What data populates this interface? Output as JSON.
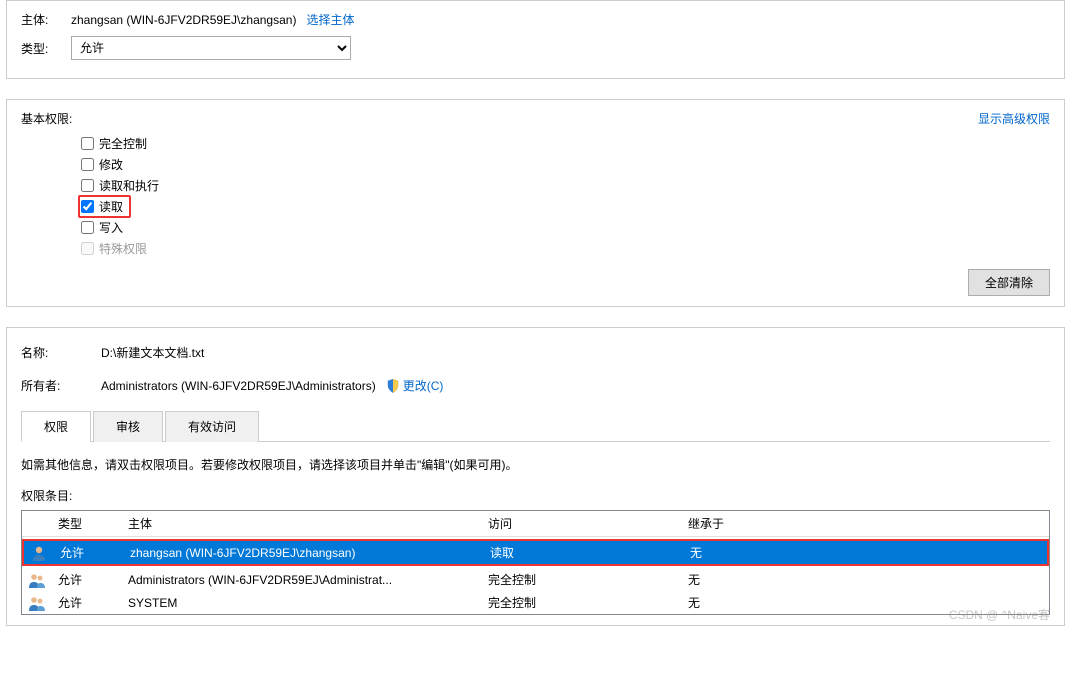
{
  "top": {
    "principal_label": "主体:",
    "principal_name": "zhangsan (WIN-6JFV2DR59EJ\\zhangsan)",
    "select_principal_link": "选择主体",
    "type_label": "类型:",
    "type_value": "允许"
  },
  "permissions_panel": {
    "title": "基本权限:",
    "show_advanced": "显示高级权限",
    "items": [
      {
        "label": "完全控制",
        "checked": false,
        "disabled": false
      },
      {
        "label": "修改",
        "checked": false,
        "disabled": false
      },
      {
        "label": "读取和执行",
        "checked": false,
        "disabled": false
      },
      {
        "label": "读取",
        "checked": true,
        "disabled": false,
        "highlight": true
      },
      {
        "label": "写入",
        "checked": false,
        "disabled": false
      },
      {
        "label": "特殊权限",
        "checked": false,
        "disabled": true
      }
    ],
    "clear_all": "全部清除"
  },
  "advanced": {
    "name_label": "名称:",
    "name_value": "D:\\新建文本文档.txt",
    "owner_label": "所有者:",
    "owner_value": "Administrators (WIN-6JFV2DR59EJ\\Administrators)",
    "change_link": "更改(C)",
    "tabs": [
      "权限",
      "审核",
      "有效访问"
    ],
    "active_tab": 0,
    "instruction": "如需其他信息，请双击权限项目。若要修改权限项目，请选择该项目并单击\"编辑\"(如果可用)。",
    "entries_label": "权限条目:",
    "columns": {
      "type": "类型",
      "principal": "主体",
      "access": "访问",
      "inherited": "继承于"
    },
    "rows": [
      {
        "icon": "single-user",
        "type": "允许",
        "principal": "zhangsan (WIN-6JFV2DR59EJ\\zhangsan)",
        "access": "读取",
        "inherited": "无",
        "selected": true,
        "highlight": true
      },
      {
        "icon": "multi-user",
        "type": "允许",
        "principal": "Administrators (WIN-6JFV2DR59EJ\\Administrat...",
        "access": "完全控制",
        "inherited": "无",
        "selected": false
      },
      {
        "icon": "multi-user",
        "type": "允许",
        "principal": "SYSTEM",
        "access": "完全控制",
        "inherited": "无",
        "selected": false
      }
    ],
    "watermark": "CSDN @ ^Naive客"
  }
}
